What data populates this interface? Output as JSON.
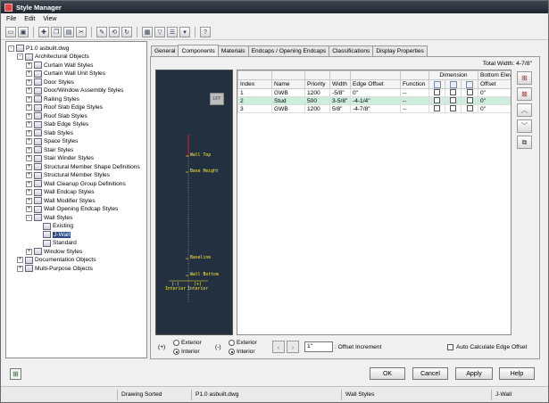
{
  "window": {
    "title": "Style Manager"
  },
  "menu": [
    "File",
    "Edit",
    "View"
  ],
  "toolbar_icons": [
    "open-icon",
    "save-icon",
    "new-icon",
    "copy-icon",
    "paste-icon",
    "cut-icon",
    "edit-icon",
    "purge-icon",
    "filter-icon",
    "view-icon",
    "help-icon",
    "toggle-icon",
    "settings-icon",
    "refresh-icon"
  ],
  "tree": [
    {
      "label": "P1.0 asbuilt.dwg",
      "level": 0,
      "exp": "-"
    },
    {
      "label": "Architectural Objects",
      "level": 1,
      "exp": "-"
    },
    {
      "label": "Curtain Wall Styles",
      "level": 2,
      "exp": "+"
    },
    {
      "label": "Curtain Wall Unit Styles",
      "level": 2,
      "exp": "+"
    },
    {
      "label": "Door Styles",
      "level": 2,
      "exp": "+"
    },
    {
      "label": "Door/Window Assembly Styles",
      "level": 2,
      "exp": "+"
    },
    {
      "label": "Railing Styles",
      "level": 2,
      "exp": "+"
    },
    {
      "label": "Roof Slab Edge Styles",
      "level": 2,
      "exp": "+"
    },
    {
      "label": "Roof Slab Styles",
      "level": 2,
      "exp": "+"
    },
    {
      "label": "Slab Edge Styles",
      "level": 2,
      "exp": "+"
    },
    {
      "label": "Slab Styles",
      "level": 2,
      "exp": "+"
    },
    {
      "label": "Space Styles",
      "level": 2,
      "exp": "+"
    },
    {
      "label": "Stair Styles",
      "level": 2,
      "exp": "+"
    },
    {
      "label": "Stair Winder Styles",
      "level": 2,
      "exp": "+"
    },
    {
      "label": "Structural Member Shape Definitions",
      "level": 2,
      "exp": "+"
    },
    {
      "label": "Structural Member Styles",
      "level": 2,
      "exp": "+"
    },
    {
      "label": "Wall Cleanup Group Definitions",
      "level": 2,
      "exp": "+"
    },
    {
      "label": "Wall Endcap Styles",
      "level": 2,
      "exp": "+"
    },
    {
      "label": "Wall Modifier Styles",
      "level": 2,
      "exp": "+"
    },
    {
      "label": "Wall Opening Endcap Styles",
      "level": 2,
      "exp": "+"
    },
    {
      "label": "Wall Styles",
      "level": 2,
      "exp": "-"
    },
    {
      "label": "Existing",
      "level": 3,
      "exp": ""
    },
    {
      "label": "J-Wall",
      "level": 3,
      "exp": "",
      "selected": true
    },
    {
      "label": "Standard",
      "level": 3,
      "exp": ""
    },
    {
      "label": "Window Styles",
      "level": 2,
      "exp": "+"
    },
    {
      "label": "Documentation Objects",
      "level": 1,
      "exp": "+"
    },
    {
      "label": "Multi-Purpose Objects",
      "level": 1,
      "exp": "+"
    }
  ],
  "tabs": [
    "General",
    "Components",
    "Materials",
    "Endcaps / Opening Endcaps",
    "Classifications",
    "Display Properties"
  ],
  "active_tab": 1,
  "total_width": "Total Width: 4-7/8\"",
  "preview": {
    "badge": "LFT",
    "labels": [
      "Wall Top",
      "Base Height",
      "Baseline",
      "Wall Bottom"
    ],
    "left_side": "(-)\nInterior",
    "right_side": "(+)\nInterior"
  },
  "grid": {
    "group_header": "Dimension",
    "group_header2": "Bottom Eleva",
    "headers": [
      "Index",
      "Name",
      "Priority",
      "Width",
      "Edge Offset",
      "Function",
      "",
      "",
      "",
      "Offset"
    ],
    "rows": [
      {
        "index": "1",
        "name": "GWB",
        "priority": "1200",
        "width": "-5/8\"",
        "edge_offset": "0\"",
        "function": "--",
        "offset": "0\""
      },
      {
        "index": "2",
        "name": "Stud",
        "priority": "500",
        "width": "3-5/8\"",
        "edge_offset": "-4-1/4\"",
        "function": "--",
        "offset": "0\"",
        "selected": true
      },
      {
        "index": "3",
        "name": "GWB",
        "priority": "1200",
        "width": "5/8\"",
        "edge_offset": "-4-7/8\"",
        "function": "--",
        "offset": "0\""
      }
    ]
  },
  "side_buttons": [
    "add-component-icon",
    "delete-component-icon",
    "move-up-icon",
    "move-down-icon",
    "copy-component-icon"
  ],
  "bottom": {
    "left_sign": "(+)",
    "right_sign": "(-)",
    "exterior": "Exterior",
    "interior": "Interior",
    "offset_value": "1\"",
    "offset_label": ": Offset Increment",
    "auto_calc": "Auto Calculate Edge Offset"
  },
  "buttons": {
    "ok": "OK",
    "cancel": "Cancel",
    "apply": "Apply",
    "help": "Help"
  },
  "status": {
    "s1": "Drawing Sorted",
    "s2": "P1.0 asbuilt.dwg",
    "s3": "Wall Styles",
    "s4": "J-Wall"
  }
}
